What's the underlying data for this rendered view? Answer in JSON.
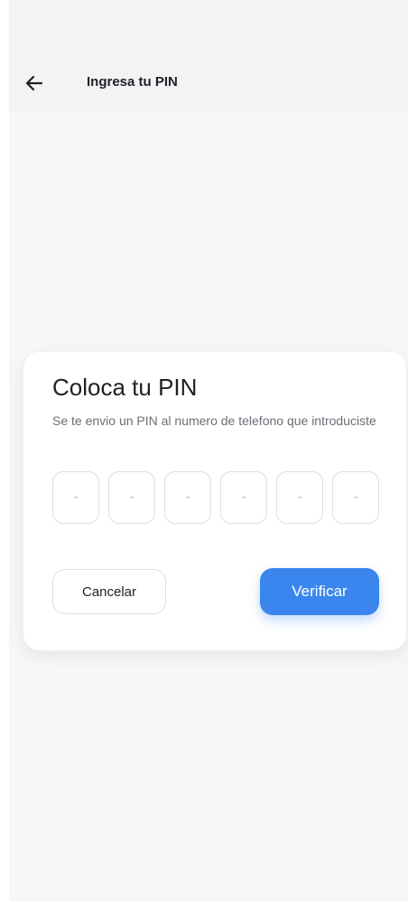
{
  "header": {
    "title": "Ingresa tu PIN",
    "back_icon": "arrow-left-icon"
  },
  "card": {
    "title": "Coloca tu PIN",
    "subtitle": "Se te envio un PIN al numero de telefono que introduciste",
    "pin_placeholders": [
      "-",
      "-",
      "-",
      "-",
      "-",
      "-"
    ],
    "cancel_label": "Cancelar",
    "verify_label": "Verificar"
  },
  "colors": {
    "accent": "#3a86ee",
    "background": "#f6f7f8"
  }
}
